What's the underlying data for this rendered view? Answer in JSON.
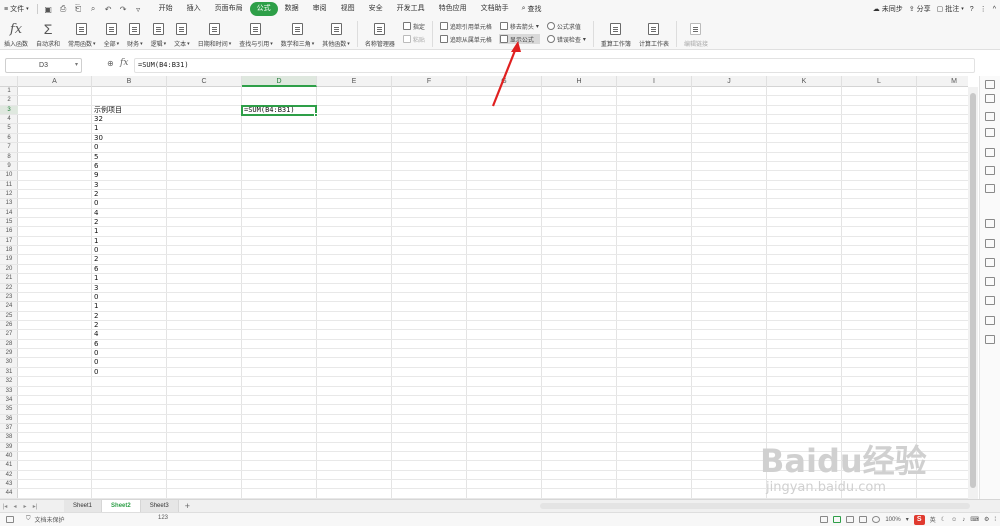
{
  "menubar": {
    "file_label": "文件",
    "tabs": [
      "开始",
      "插入",
      "页面布局",
      "公式",
      "数据",
      "审阅",
      "视图",
      "安全",
      "开发工具",
      "特色应用",
      "文档助手"
    ],
    "active_tab": "公式",
    "search_label": "查找",
    "sync_label": "未同步",
    "share_label": "分享",
    "comment_label": "批注"
  },
  "ribbon": {
    "big": [
      "插入函数",
      "自动求和",
      "常用函数",
      "全部",
      "财务",
      "逻辑",
      "文本",
      "日期和时间",
      "查找与引用",
      "数学和三角",
      "其他函数",
      "名称管理器"
    ],
    "col1": [
      "指定",
      "粘贴"
    ],
    "col2": [
      "追踪引用单元格",
      "追踪从属单元格"
    ],
    "col3": [
      "移去箭头",
      "显示公式"
    ],
    "col4": [
      "公式求值",
      "错误检查"
    ],
    "big2": [
      "重算工作簿",
      "计算工作表",
      "编辑链接"
    ]
  },
  "formula_bar": {
    "name_box": "D3",
    "fx_label": "fx",
    "formula": "=SUM(B4:B31)"
  },
  "grid": {
    "columns": [
      "A",
      "B",
      "C",
      "D",
      "E",
      "F",
      "G",
      "H",
      "I",
      "J",
      "K",
      "L",
      "M"
    ],
    "rows": [
      "1",
      "2",
      "3",
      "4",
      "5",
      "6",
      "7",
      "8",
      "9",
      "10",
      "11",
      "12",
      "13",
      "14",
      "15",
      "16",
      "17",
      "18",
      "19",
      "20",
      "21",
      "22",
      "23",
      "24",
      "25",
      "26",
      "27",
      "28",
      "29",
      "30",
      "31",
      "32",
      "33",
      "34",
      "35",
      "36",
      "37",
      "38",
      "39",
      "40",
      "41",
      "42",
      "43",
      "44"
    ],
    "selected_column": "D",
    "selected_row": "3",
    "b3_header": "示例项目",
    "b_values": [
      "32",
      "1",
      "30",
      "0",
      "5",
      "6",
      "9",
      "3",
      "2",
      "0",
      "4",
      "2",
      "1",
      "1",
      "0",
      "2",
      "6",
      "1",
      "3",
      "0",
      "1",
      "2",
      "2",
      "4",
      "6",
      "0",
      "0",
      "0"
    ],
    "d3_formula": "=SUM(B4:B31)"
  },
  "sheets": {
    "tabs": [
      "Sheet1",
      "Sheet2",
      "Sheet3"
    ],
    "active": "Sheet2",
    "add_label": "+"
  },
  "status": {
    "protect_label": "文档未保护",
    "sum_value": "123",
    "zoom": "100%",
    "ime_label": "英"
  },
  "watermark": {
    "main": "Baidu经验",
    "sub": "jingyan.baidu.com"
  },
  "colors": {
    "accent": "#2e9f48",
    "arrow": "#e02020"
  }
}
